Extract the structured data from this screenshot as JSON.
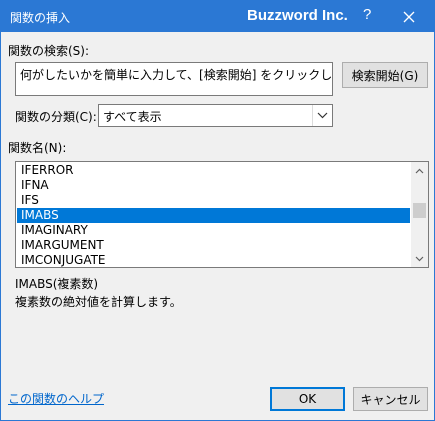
{
  "window": {
    "title": "関数の挿入",
    "company": "Buzzword Inc.",
    "help_glyph": "?"
  },
  "search": {
    "label": "関数の検索(S):",
    "value": "何がしたいかを簡単に入力して、[検索開始] をクリックしてください。",
    "button_label": "検索開始(G)"
  },
  "category": {
    "label": "関数の分類(C):",
    "selected": "すべて表示"
  },
  "function_list": {
    "label": "関数名(N):",
    "items": [
      "IFERROR",
      "IFNA",
      "IFS",
      "IMABS",
      "IMAGINARY",
      "IMARGUMENT",
      "IMCONJUGATE"
    ],
    "selected_index": 3
  },
  "description": {
    "signature": "IMABS(複素数)",
    "text": "複素数の絶対値を計算します。"
  },
  "footer": {
    "help_link": "この関数のヘルプ",
    "ok_label": "OK",
    "cancel_label": "キャンセル"
  },
  "colors": {
    "titlebar": "#2b78d4",
    "selection": "#0078d7",
    "link": "#0066cc"
  }
}
